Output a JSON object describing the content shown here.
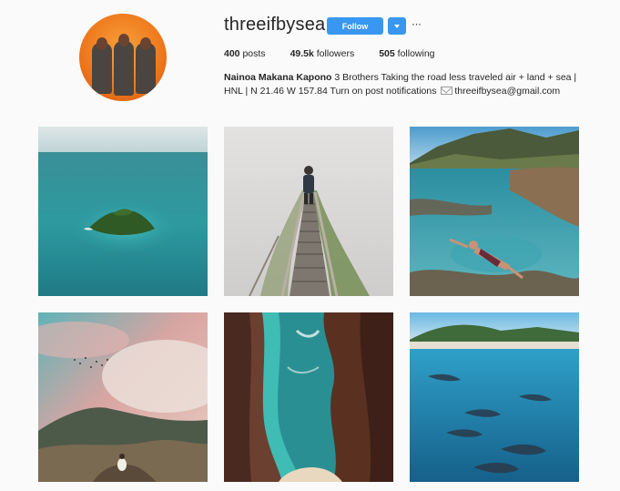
{
  "profile": {
    "username": "threeifbysea",
    "follow_label": "Follow",
    "more_label": "···",
    "stats": {
      "posts_count": "400",
      "posts_label": "posts",
      "followers_count": "49.5k",
      "followers_label": "followers",
      "following_count": "505",
      "following_label": "following"
    },
    "bio": {
      "name": "Nainoa Makana Kapono",
      "text": "3 Brothers Taking the road less traveled air + land + sea | HNL | N 21.46 W 157.84 Turn on post notifications",
      "email": "threeifbysea@gmail.com"
    }
  },
  "colors": {
    "follow_button": "#3897f0",
    "background": "#fafafa"
  },
  "posts": [
    {
      "name": "island-ocean-photo"
    },
    {
      "name": "foggy-stairway-hike-photo"
    },
    {
      "name": "tide-pool-swimmer-photo"
    },
    {
      "name": "mountain-sunset-clouds-photo"
    },
    {
      "name": "aerial-lava-cove-photo"
    },
    {
      "name": "underwater-dolphins-photo"
    }
  ]
}
